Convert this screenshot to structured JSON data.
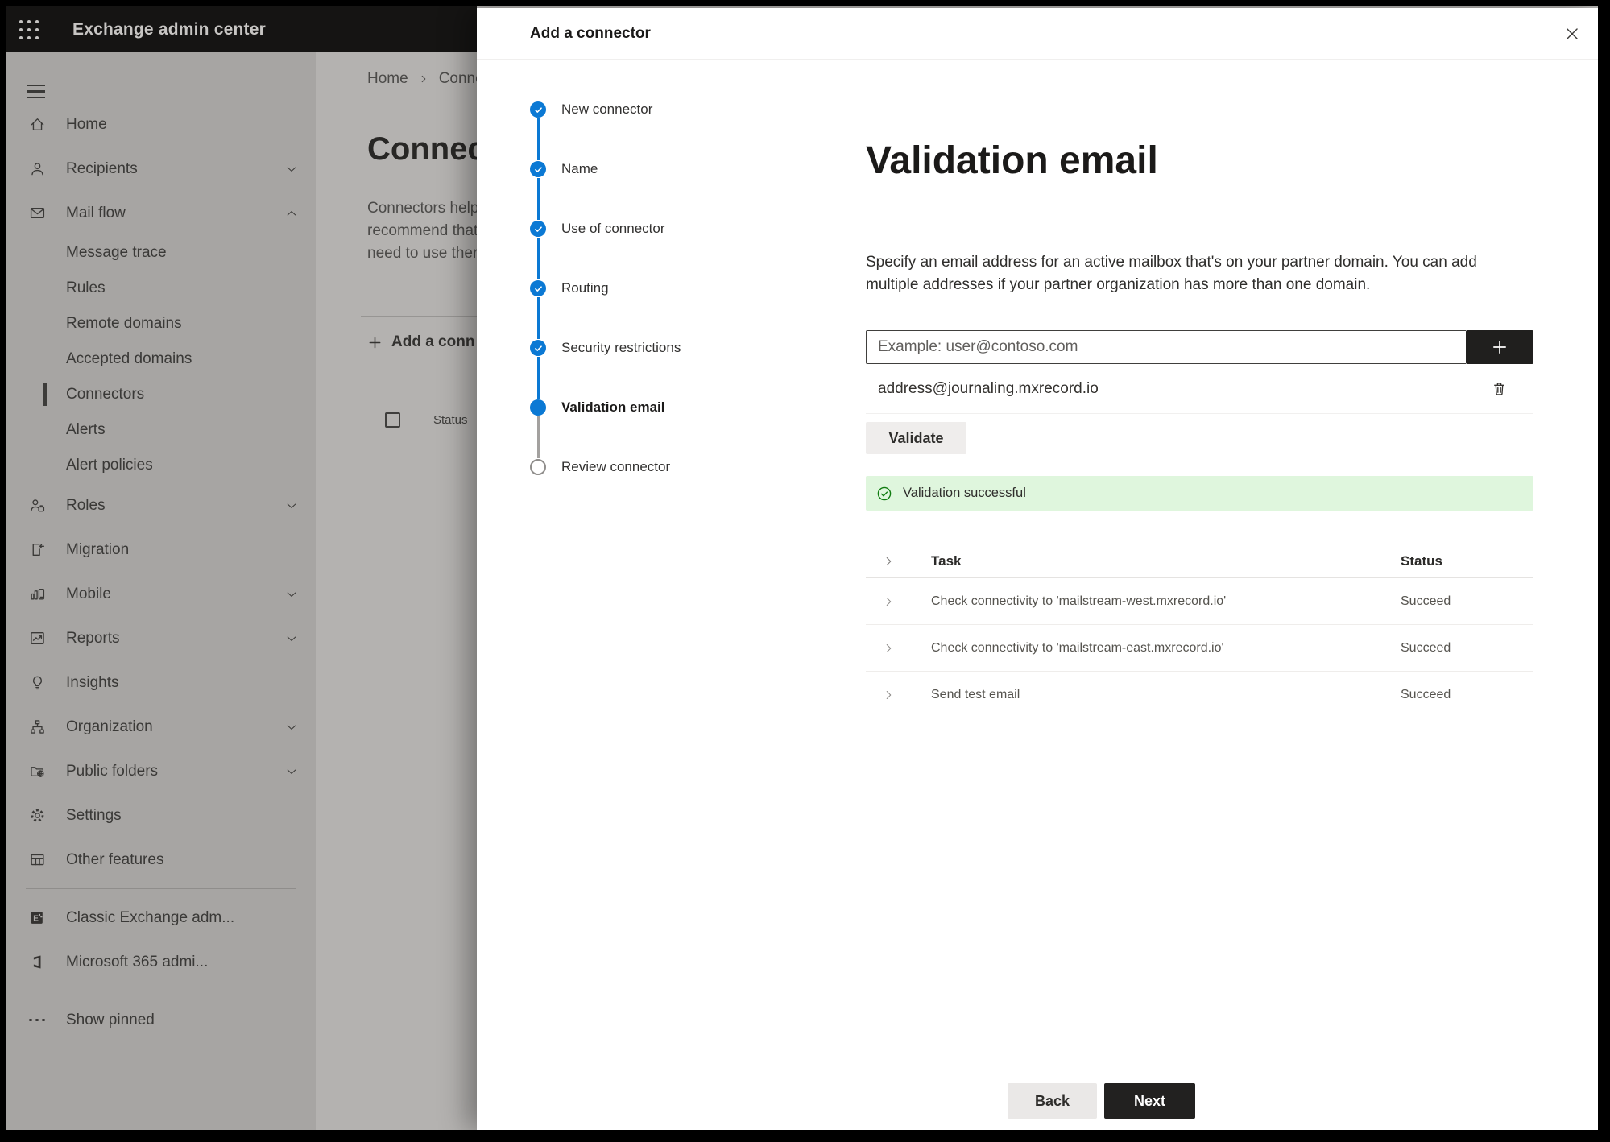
{
  "topbar": {
    "title": "Exchange admin center"
  },
  "sidebar": {
    "items": [
      {
        "label": "Home",
        "icon": "home"
      },
      {
        "label": "Recipients",
        "icon": "person",
        "expand": "down"
      },
      {
        "label": "Mail flow",
        "icon": "mail",
        "expand": "up"
      },
      {
        "label": "Message trace",
        "sub": true
      },
      {
        "label": "Rules",
        "sub": true
      },
      {
        "label": "Remote domains",
        "sub": true
      },
      {
        "label": "Accepted domains",
        "sub": true
      },
      {
        "label": "Connectors",
        "sub": true,
        "selected": true
      },
      {
        "label": "Alerts",
        "sub": true
      },
      {
        "label": "Alert policies",
        "sub": true
      },
      {
        "label": "Roles",
        "icon": "roles",
        "expand": "down"
      },
      {
        "label": "Migration",
        "icon": "migration"
      },
      {
        "label": "Mobile",
        "icon": "mobile",
        "expand": "down"
      },
      {
        "label": "Reports",
        "icon": "reports",
        "expand": "down"
      },
      {
        "label": "Insights",
        "icon": "lightbulb"
      },
      {
        "label": "Organization",
        "icon": "org-chart",
        "expand": "down"
      },
      {
        "label": "Public folders",
        "icon": "folder-globe",
        "expand": "down"
      },
      {
        "label": "Settings",
        "icon": "gear"
      },
      {
        "label": "Other features",
        "icon": "table-grid"
      },
      {
        "label": "Classic Exchange adm...",
        "icon": "exchange-logo"
      },
      {
        "label": "Microsoft 365 admi...",
        "icon": "office-logo"
      },
      {
        "label": "Show pinned",
        "icon": "ellipsis"
      }
    ]
  },
  "bgpage": {
    "breadcrumb": {
      "home": "Home",
      "current": "Conne"
    },
    "heading": "Connec",
    "para": [
      "Connectors help",
      "recommend that",
      "need to use ther"
    ],
    "add_label": "Add a conn",
    "status_header": "Status"
  },
  "panel": {
    "title": "Add a connector",
    "steps": [
      {
        "label": "New connector",
        "state": "done"
      },
      {
        "label": "Name",
        "state": "done"
      },
      {
        "label": "Use of connector",
        "state": "done"
      },
      {
        "label": "Routing",
        "state": "done"
      },
      {
        "label": "Security restrictions",
        "state": "done"
      },
      {
        "label": "Validation email",
        "state": "current"
      },
      {
        "label": "Review connector",
        "state": "todo"
      }
    ],
    "content": {
      "heading": "Validation email",
      "description": [
        "Specify an email address for an active mailbox that's on your partner domain. You can add",
        "multiple addresses if your partner organization has more than one domain."
      ],
      "input_placeholder": "Example: user@contoso.com",
      "address": "address@journaling.mxrecord.io",
      "validate_label": "Validate",
      "banner_text": "Validation successful",
      "table": {
        "headers": [
          "Task",
          "Status"
        ],
        "rows": [
          {
            "task": "Check connectivity to 'mailstream-west.mxrecord.io'",
            "status": "Succeed"
          },
          {
            "task": "Check connectivity to 'mailstream-east.mxrecord.io'",
            "status": "Succeed"
          },
          {
            "task": "Send test email",
            "status": "Succeed"
          }
        ]
      }
    },
    "footer": {
      "back": "Back",
      "next": "Next"
    }
  },
  "colors": {
    "accent_blue": "#0b79d4",
    "success_banner_bg": "#dff6dd",
    "success_green": "#107c10",
    "dark_button": "#201f1e",
    "topbar_bg": "#151413"
  }
}
